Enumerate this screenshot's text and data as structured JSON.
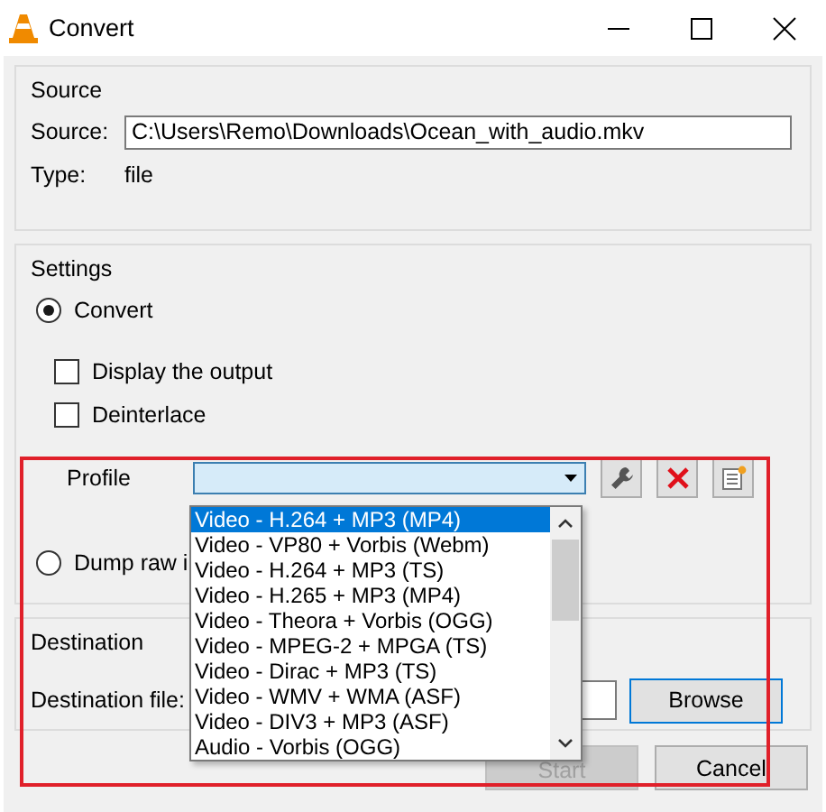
{
  "window": {
    "title": "Convert"
  },
  "source": {
    "title": "Source",
    "label": "Source:",
    "value": "C:\\Users\\Remo\\Downloads\\Ocean_with_audio.mkv",
    "type_label": "Type:",
    "type_value": "file"
  },
  "settings": {
    "title": "Settings",
    "modes": [
      {
        "label": "Convert",
        "selected": true
      },
      {
        "label": "Dump raw i",
        "selected": false
      }
    ],
    "options": [
      {
        "label": "Display the output",
        "checked": false
      },
      {
        "label": "Deinterlace",
        "checked": false
      }
    ],
    "profile_label": "Profile",
    "profile_list": [
      {
        "label": "Video - H.264 + MP3 (MP4)",
        "selected": true
      },
      {
        "label": "Video - VP80 + Vorbis (Webm)",
        "selected": false
      },
      {
        "label": "Video - H.264 + MP3 (TS)",
        "selected": false
      },
      {
        "label": "Video - H.265 + MP3 (MP4)",
        "selected": false
      },
      {
        "label": "Video - Theora + Vorbis (OGG)",
        "selected": false
      },
      {
        "label": "Video - MPEG-2 + MPGA (TS)",
        "selected": false
      },
      {
        "label": "Video - Dirac + MP3 (TS)",
        "selected": false
      },
      {
        "label": "Video - WMV + WMA (ASF)",
        "selected": false
      },
      {
        "label": "Video - DIV3 + MP3 (ASF)",
        "selected": false
      },
      {
        "label": "Audio - Vorbis (OGG)",
        "selected": false
      }
    ]
  },
  "destination": {
    "title": "Destination",
    "file_label": "Destination file:",
    "browse": "Browse"
  },
  "buttons": [
    {
      "label": "Start",
      "disabled": true
    },
    {
      "label": "Cancel",
      "disabled": false
    }
  ]
}
